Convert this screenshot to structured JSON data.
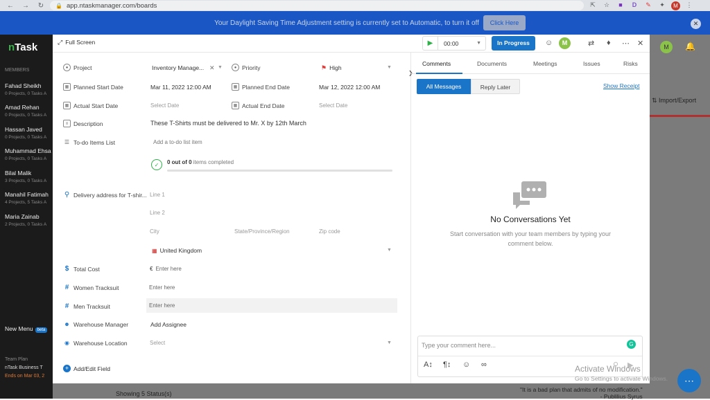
{
  "browser": {
    "url": "app.ntaskmanager.com/boards",
    "profile_initial": "M"
  },
  "banner": {
    "text": "Your Daylight Saving Time Adjustment setting is currently set to Automatic, to turn it off",
    "button": "Click Here"
  },
  "sidebar": {
    "logo": "Task",
    "members_title": "MEMBERS",
    "members": [
      {
        "name": "Fahad Sheikh",
        "stats": "0 Projects, 0 Tasks A"
      },
      {
        "name": "Amad Rehan",
        "stats": "0 Projects, 0 Tasks A"
      },
      {
        "name": "Hassan Javed",
        "stats": "0 Projects, 0 Tasks A"
      },
      {
        "name": "Muhammad Ehsa",
        "stats": "0 Projects, 0 Tasks A"
      },
      {
        "name": "Bilal Malik",
        "stats": "3 Projects, 0 Tasks A"
      },
      {
        "name": "Manahil Fatimah",
        "stats": "4 Projects, 5 Tasks A"
      },
      {
        "name": "Maria Zainab",
        "stats": "2 Projects, 0 Tasks A"
      }
    ],
    "new_menu": "New Menu",
    "beta": "beta",
    "team_plan": "Team Plan",
    "business": "nTask Business T",
    "ends": "Ends on Mar 03, 2"
  },
  "background": {
    "import_export": "Import/Export",
    "showing": "Showing 5 Status(s)",
    "quote": "\"It is a bad plan that admits of no modification.\"",
    "quote_author": "- Publilius Syrus",
    "avatar": "M",
    "notif_count": "10"
  },
  "header": {
    "full_screen": "Full Screen",
    "timer": "00:00",
    "status": "In Progress",
    "avatar": "M"
  },
  "form": {
    "project_label": "Project",
    "project_value": "Inventory Manage...",
    "priority_label": "Priority",
    "priority_value": "High",
    "planned_start_label": "Planned Start Date",
    "planned_start_value": "Mar 11, 2022 12:00 AM",
    "planned_end_label": "Planned End Date",
    "planned_end_value": "Mar 12, 2022 12:00 AM",
    "actual_start_label": "Actual Start Date",
    "actual_start_value": "Select Date",
    "actual_end_label": "Actual End Date",
    "actual_end_value": "Select Date",
    "description_label": "Description",
    "description_value": "These T-Shirts must be delivered to Mr. X by 12th March",
    "todo_label": "To-do Items List",
    "todo_placeholder": "Add a to-do list item",
    "todo_count": "0 out of 0",
    "todo_completed": "items completed",
    "todo_progress": 0,
    "delivery_label": "Delivery address for T-shir...",
    "line1": "Line 1",
    "line2": "Line 2",
    "city": "City",
    "state": "State/Province/Region",
    "zip": "Zip code",
    "country": "United Kingdom",
    "total_cost_label": "Total Cost",
    "currency": "€",
    "total_cost_placeholder": "Enter here",
    "women_label": "Women Tracksuit",
    "women_placeholder": "Enter here",
    "men_label": "Men Tracksuit",
    "men_placeholder": "Enter here",
    "warehouse_manager_label": "Warehouse Manager",
    "warehouse_manager_value": "Add Assignee",
    "warehouse_location_label": "Warehouse Location",
    "warehouse_location_value": "Select",
    "add_edit_field": "Add/Edit Field"
  },
  "panel": {
    "tabs": [
      "Comments",
      "Documents",
      "Meetings",
      "Issues",
      "Risks"
    ],
    "all_messages": "All Messages",
    "reply_later": "Reply Later",
    "show_receipt": "Show Receipt",
    "empty_title": "No Conversations Yet",
    "empty_sub": "Start conversation with your team members by typing your comment below.",
    "comment_placeholder": "Type your comment here..."
  },
  "watermark": {
    "line1": "Activate Windows",
    "line2": "Go to Settings to activate Windows."
  }
}
